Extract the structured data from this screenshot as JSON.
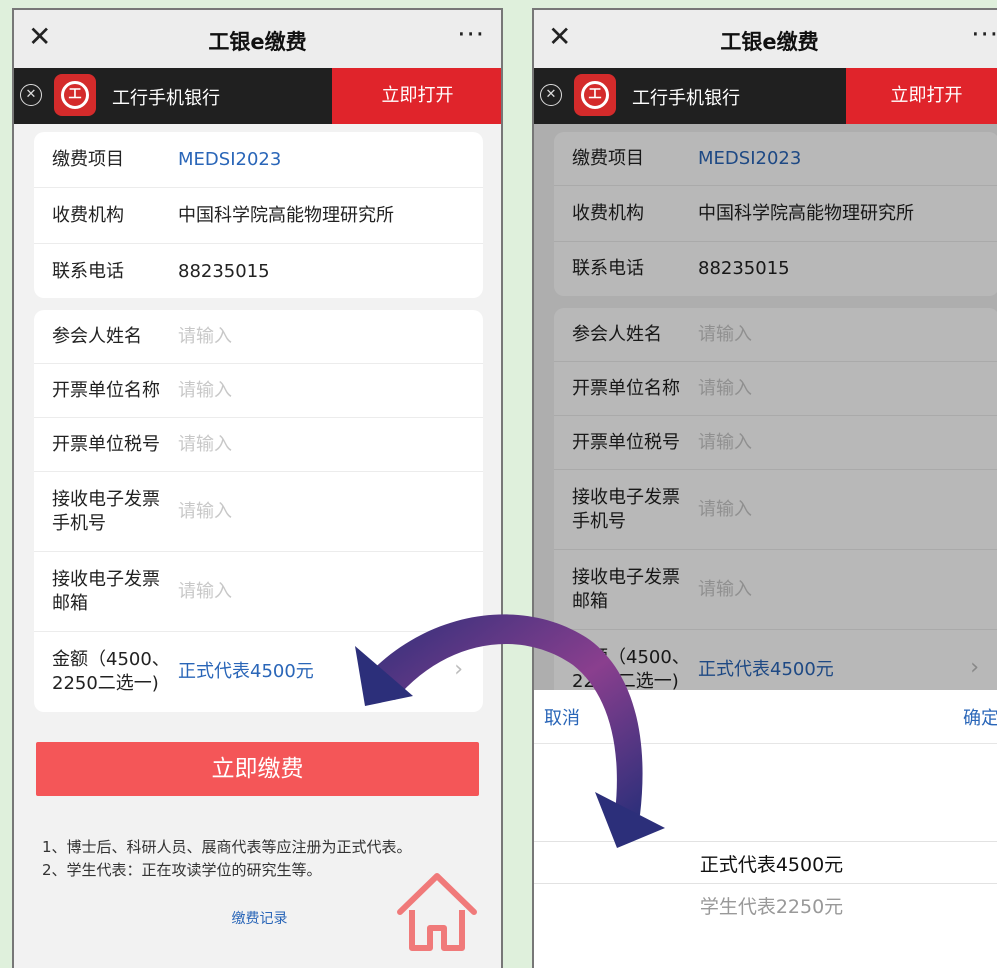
{
  "app": {
    "title": "工银e缴费",
    "bank_name": "工行手机银行",
    "open_label": "立即打开"
  },
  "info": [
    {
      "label": "缴费项目",
      "value": "MEDSI2023",
      "blue": true
    },
    {
      "label": "收费机构",
      "value": "中国科学院高能物理研究所",
      "blue": false
    },
    {
      "label": "联系电话",
      "value": "88235015",
      "blue": false
    }
  ],
  "form": {
    "placeholder": "请输入",
    "fields": [
      "参会人姓名",
      "开票单位名称",
      "开票单位税号",
      "接收电子发票手机号",
      "接收电子发票邮箱"
    ],
    "amount_label": "金额（4500、2250二选一)",
    "amount_value": "正式代表4500元"
  },
  "pay_button": "立即缴费",
  "notes": [
    "1、博士后、科研人员、展商代表等应注册为正式代表。",
    "2、学生代表：正在攻读学位的研究生等。"
  ],
  "record_link": "缴费记录",
  "picker": {
    "cancel": "取消",
    "confirm": "确定",
    "options": [
      "正式代表4500元",
      "学生代表2250元"
    ],
    "selected": 0
  },
  "colors": {
    "accent_blue": "#2a66b8",
    "pay_red": "#f45658",
    "banner_red": "#e0242b"
  }
}
